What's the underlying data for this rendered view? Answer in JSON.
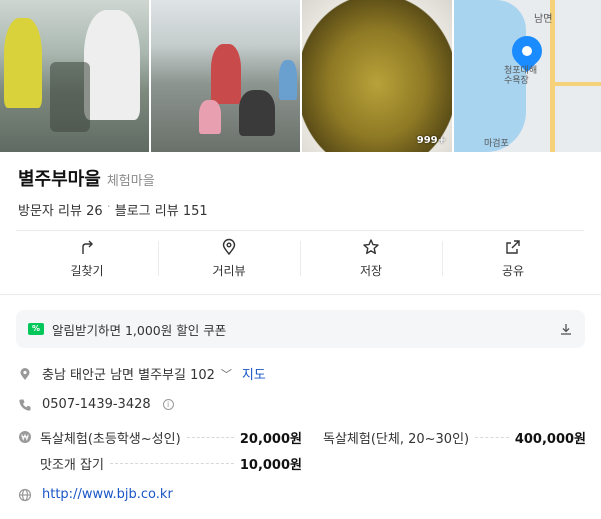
{
  "gallery": {
    "photo_count_badge": "999+",
    "map": {
      "label_top": "남면",
      "label_pin": "청포대해수욕장",
      "label_bottom": "마검포"
    }
  },
  "place": {
    "name": "별주부마을",
    "category": "체험마을",
    "visitor_reviews_label": "방문자 리뷰 26",
    "blog_reviews_label": "블로그 리뷰 151"
  },
  "actions": [
    {
      "label": "길찾기",
      "icon": "directions-icon"
    },
    {
      "label": "거리뷰",
      "icon": "street-view-icon"
    },
    {
      "label": "저장",
      "icon": "star-icon"
    },
    {
      "label": "공유",
      "icon": "share-icon"
    }
  ],
  "coupon": {
    "text": "알림받기하면 1,000원 할인 쿠폰",
    "icon": "coupon-icon"
  },
  "info": {
    "address": "충남 태안군 남면 별주부길 102",
    "map_link": "지도",
    "phone": "0507-1439-3428",
    "website": "http://www.bjb.co.kr"
  },
  "menu": [
    {
      "name": "독살체험(초등학생~성인)",
      "price": "20,000원"
    },
    {
      "name": "독살체험(단체, 20~30인)",
      "price": "400,000원"
    },
    {
      "name": "맛조개 잡기",
      "price": "10,000원"
    }
  ],
  "colors": {
    "brand_green": "#03c75a",
    "link_blue": "#1a56c7",
    "pin_blue": "#1a8cff"
  }
}
